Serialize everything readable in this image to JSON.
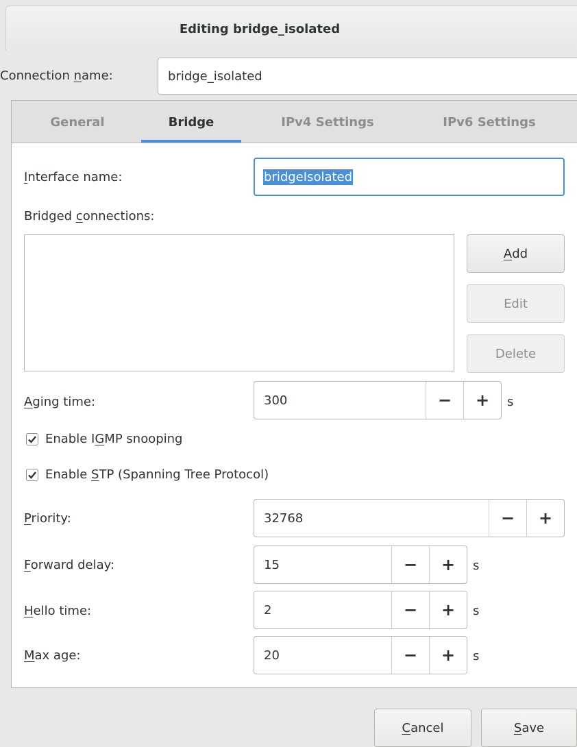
{
  "window": {
    "title": "Editing bridge_isolated"
  },
  "connection": {
    "label": "Connection name:",
    "label_pre": "Connection ",
    "label_ul": "n",
    "label_post": "ame:",
    "value": "bridge_isolated"
  },
  "tabs": [
    {
      "label": "General"
    },
    {
      "label": "Bridge"
    },
    {
      "label": "IPv4 Settings"
    },
    {
      "label": "IPv6 Settings"
    }
  ],
  "bridge": {
    "interface_name": {
      "ul": "I",
      "rest": "nterface name:",
      "value": "bridgeIsolated"
    },
    "bridged_connections": {
      "pre": "Bridged ",
      "ul": "c",
      "post": "onnections:"
    },
    "buttons": {
      "add_ul": "A",
      "add_rest": "dd",
      "edit": "Edit",
      "delete": "Delete"
    },
    "aging_time": {
      "ul": "A",
      "rest": "ging time:",
      "value": "300",
      "unit": "s"
    },
    "igmp": {
      "pre": "Enable I",
      "ul": "G",
      "post": "MP snooping",
      "checked": true
    },
    "stp": {
      "pre": "Enable ",
      "ul": "S",
      "post": "TP (Spanning Tree Protocol)",
      "checked": true
    },
    "priority": {
      "ul": "P",
      "rest": "riority:",
      "value": "32768"
    },
    "forward_delay": {
      "ul": "F",
      "rest": "orward delay:",
      "value": "15",
      "unit": "s"
    },
    "hello_time": {
      "ul": "H",
      "rest": "ello time:",
      "value": "2",
      "unit": "s"
    },
    "max_age": {
      "ul": "M",
      "rest": "ax age:",
      "value": "20",
      "unit": "s"
    }
  },
  "spin_symbols": {
    "minus": "−",
    "plus": "+"
  },
  "footer": {
    "cancel_ul": "C",
    "cancel_rest": "ancel",
    "save_ul": "S",
    "save_rest": "ave"
  }
}
